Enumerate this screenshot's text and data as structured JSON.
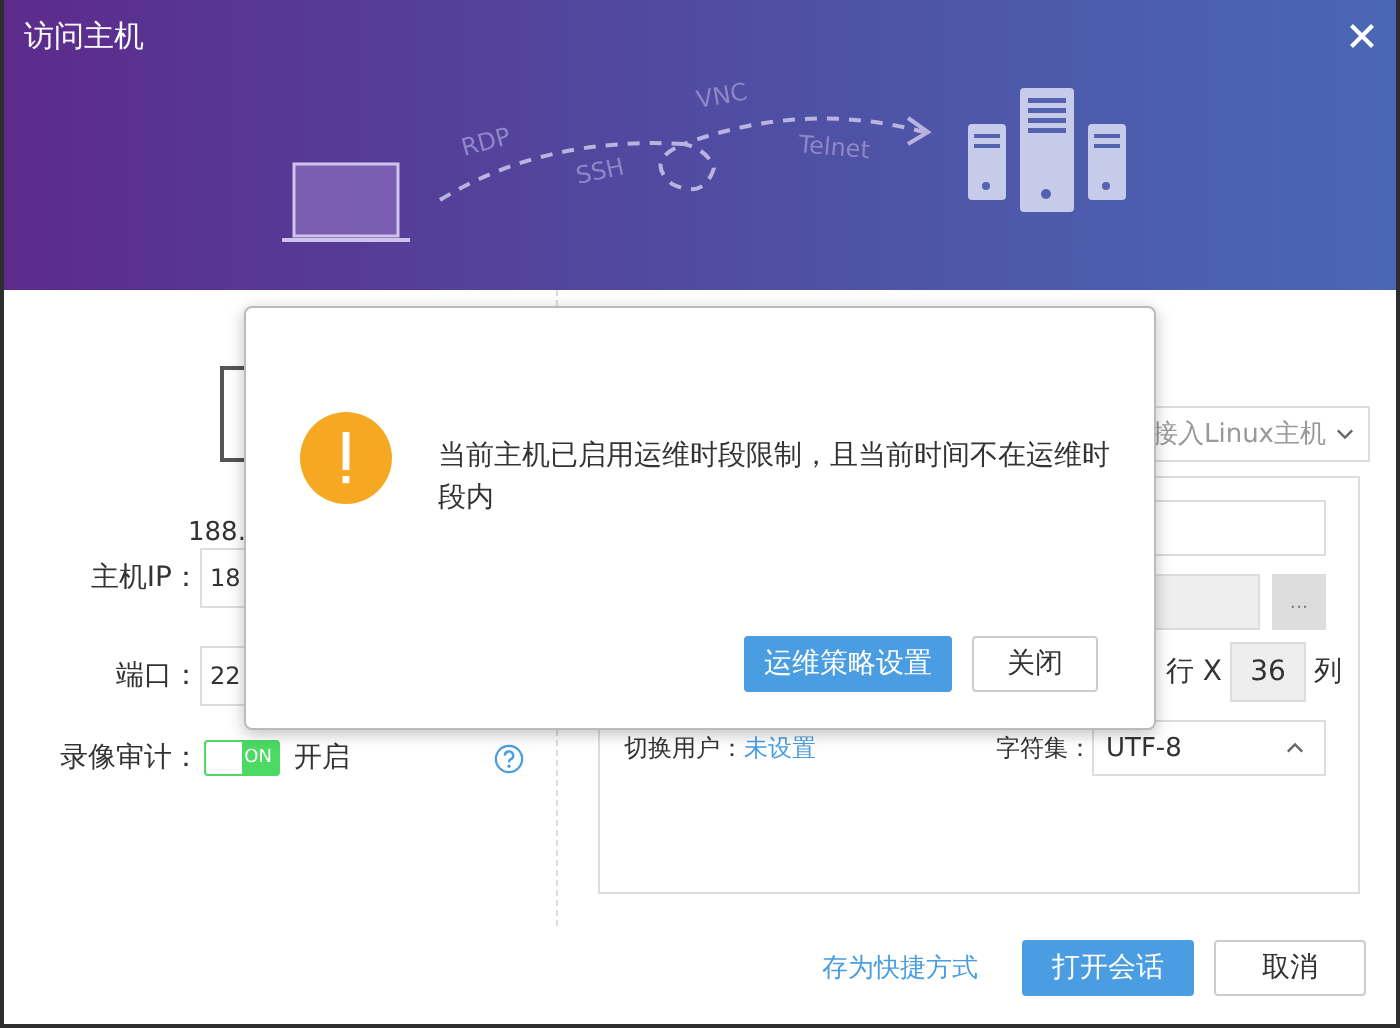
{
  "window": {
    "title": "访问主机"
  },
  "banner": {
    "protocols": [
      {
        "label": "RDP"
      },
      {
        "label": "SSH"
      },
      {
        "label": "VNC"
      },
      {
        "label": "Telnet"
      }
    ]
  },
  "host": {
    "address": "188."
  },
  "form": {
    "fields": [
      {
        "label": "主机IP：",
        "value": "18"
      },
      {
        "label": "端口：",
        "value": "22"
      }
    ],
    "recording": {
      "label": "录像审计：",
      "on": true,
      "toggle_text": "ON",
      "status": "开启"
    }
  },
  "settings": {
    "mode_dropdown": "接入Linux主机",
    "browse_button": "...",
    "rows_label": "行 X",
    "columns_value": "36",
    "columns_label": "列",
    "switch_user": {
      "label": "切换用户：",
      "value": "未设置"
    },
    "charset": {
      "label": "字符集：",
      "value": "UTF-8"
    }
  },
  "footer": {
    "shortcut_link": "存为快捷方式",
    "buttons": [
      {
        "label": "打开会话",
        "primary": true
      },
      {
        "label": "取消",
        "primary": false
      }
    ]
  },
  "alert": {
    "message": "当前主机已启用运维时段限制，且当前时间不在运维时段内",
    "buttons": [
      {
        "label": "运维策略设置",
        "primary": true
      },
      {
        "label": "关闭",
        "primary": false
      }
    ]
  }
}
